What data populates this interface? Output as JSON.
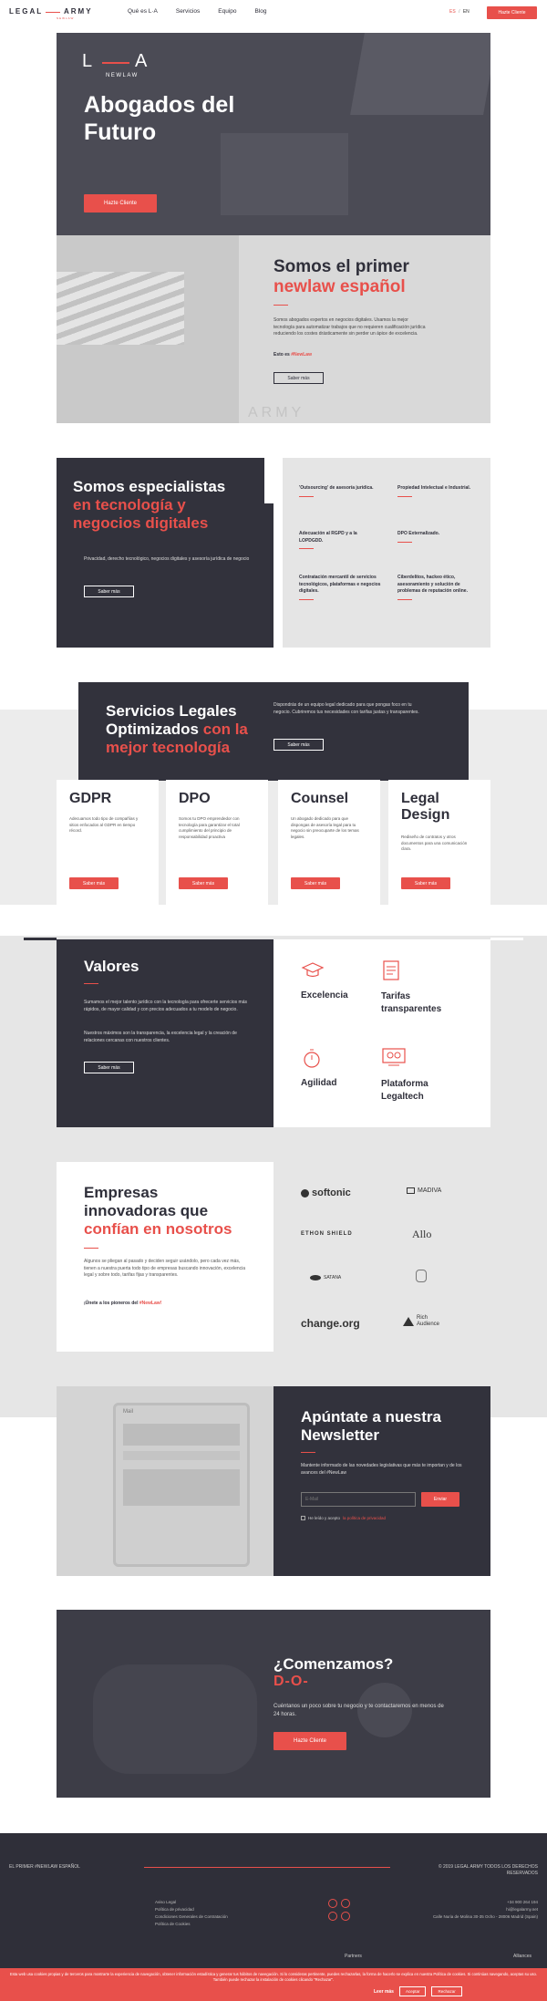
{
  "header": {
    "logo_left": "LEGAL",
    "logo_right": "ARMY",
    "logo_sub": "NEWLAW",
    "nav": [
      "Qué es L·A",
      "Servicios",
      "Equipo",
      "Blog"
    ],
    "lang_es": "ES",
    "lang_sep": "/",
    "lang_en": "EN",
    "cta": "Hazte Cliente"
  },
  "hero": {
    "logo_l": "L",
    "logo_a": "A",
    "logo_newlaw": "NEWLAW",
    "title_line1": "Abogados del",
    "title_line2": "Futuro",
    "cta": "Hazte Cliente"
  },
  "intro": {
    "title_line1": "Somos el primer",
    "title_line2": "newlaw español",
    "body": "Somos abogados expertos en negocios digitales. Usamos la mejor tecnología para automatizar trabajos que no requieren cualificación jurídica reduciendo los costes drásticamente sin perder un ápice de excelencia.",
    "tag_prefix": "Esto es",
    "tag": "#NewLaw",
    "button": "Saber más",
    "watermark": "ARMY"
  },
  "specialists": {
    "title_line1": "Somos especialistas",
    "title_line2": "en tecnología y",
    "title_line3": "negocios digitales",
    "body": "Privacidad, derecho tecnológico, negocios digitales y asesoría jurídica de negocio",
    "button": "Saber más",
    "items": [
      "'Outsourcing' de asesoría jurídica.",
      "Propiedad Intelectual e Industrial.",
      "Adecuación al RGPD y a la LOPDGDD.",
      "DPO Externalizado.",
      "Contratación mercantil de servicios tecnológicos, plataformas e negocios digitales.",
      "Ciberdelitos, hackeo ético, asesoramiento y solución de problemas de reputación online."
    ]
  },
  "services": {
    "title_line1": "Servicios Legales",
    "title_line2a": "Optimizados",
    "title_line2b": "con la",
    "title_line3": "mejor tecnología",
    "body": "Dispondrás de un equipo legal dedicado para que pongas foco en tu negocio. Cubriremos tus necesidades con tarifas justas y transparentes.",
    "button": "Saber más",
    "cards": [
      {
        "title": "GDPR",
        "text": "Adecuamos todo tipo de compañías y sitios enfocados al GDPR en tiempo récord.",
        "button": "Saber más"
      },
      {
        "title": "DPO",
        "text": "Somos tu DPO emprendedor con tecnología para garantizar el total cumplimiento del principio de responsabilidad proactiva",
        "button": "Saber más"
      },
      {
        "title": "Counsel",
        "text": "Un abogado dedicado para que dispongas de asesoría legal para tu negocio sin preocuparte de los temas legales.",
        "button": "Saber más"
      },
      {
        "title": "Legal Design",
        "text": "Rediseño de contratos y otros documentos para una comunicación clara.",
        "button": "Saber más"
      }
    ]
  },
  "values": {
    "title": "Valores",
    "p1": "Sumamos el mejor talento jurídico con la tecnología para ofrecerte servicios más rápidos, de mayor calidad y con precios adecuados a tu modelo de negocio.",
    "p2": "Nuestros máximos son la transparencia, la excelencia legal y la creación de relaciones cercanas con nuestros clientes.",
    "button": "Saber más",
    "items": [
      "Excelencia",
      "Tarifas transparentes",
      "Agilidad",
      "Plataforma Legaltech"
    ]
  },
  "clients": {
    "title_line1": "Empresas",
    "title_line2": "innovadoras que",
    "title_line3": "confían en nosotros",
    "body": "Algunos se pliegan al pasado y deciden seguir usándolo, pero cada vez más, tienen a nuestra puerta todo tipo de empresas buscando innovación, excelencia legal y sobre todo, tarifas fijas y transparentes.",
    "join_prefix": "¡Únete a los pioneros del",
    "join_tag": "#NewLaw!",
    "logos": [
      "softonic",
      "MADIVA",
      "ETHON SHIELD",
      "Allo",
      "SATANA",
      "",
      "change.org",
      "Rich Audience"
    ]
  },
  "newsletter": {
    "title_line1": "Apúntate a nuestra",
    "title_line2": "Newsletter",
    "body": "Mantente informado de las novedades legislativas que más te importan y de los avances del #NewLaw",
    "placeholder": "E-Mail",
    "button": "Enviar",
    "consent_prefix": "He leído y acepto",
    "consent_link": "la política de privacidad",
    "mock_title": "Mail"
  },
  "start": {
    "title": "¿Comenzamos?",
    "subtitle": "D-O-",
    "body": "Cuéntanos un poco sobre tu negocio y te contactaremos en menos de 24 horas.",
    "button": "Hazte Cliente"
  },
  "footer": {
    "left": "EL PRIMER #NEWLAW ESPAÑOL",
    "right": "© 2019 LEGAL ARMY TODOS LOS DERECHOS RESERVADOS",
    "links": [
      "Aviso Legal",
      "Política de privacidad",
      "Condiciones Generales de Contratación",
      "Política de Cookies"
    ],
    "contact": [
      "+34 900 264 194",
      "hi@legalarmy.net",
      "Calle Nuria de Molina 30-35 Ocho - 28006 Madrid (Spain)"
    ],
    "partners": "Partners",
    "alliances": "Alliances"
  },
  "cookie": {
    "text": "Esta web usa cookies propias y de terceros para mostrarte la experiencia de navegación, obtener información estadística y generar tus hábitos de navegación. Si lo consideras pertinente, puedes rechazarlas, la forma de hacerlo se explica en nuestra Política de cookies. Si continúas navegando, aceptas su uso. También puede rechazar la instalación de cookies clicando \"Rechazar\".",
    "link": "Leer más",
    "accept": "Aceptar",
    "reject": "Rechazar"
  },
  "colors": {
    "accent": "#e8504b",
    "dark": "#32323c"
  }
}
